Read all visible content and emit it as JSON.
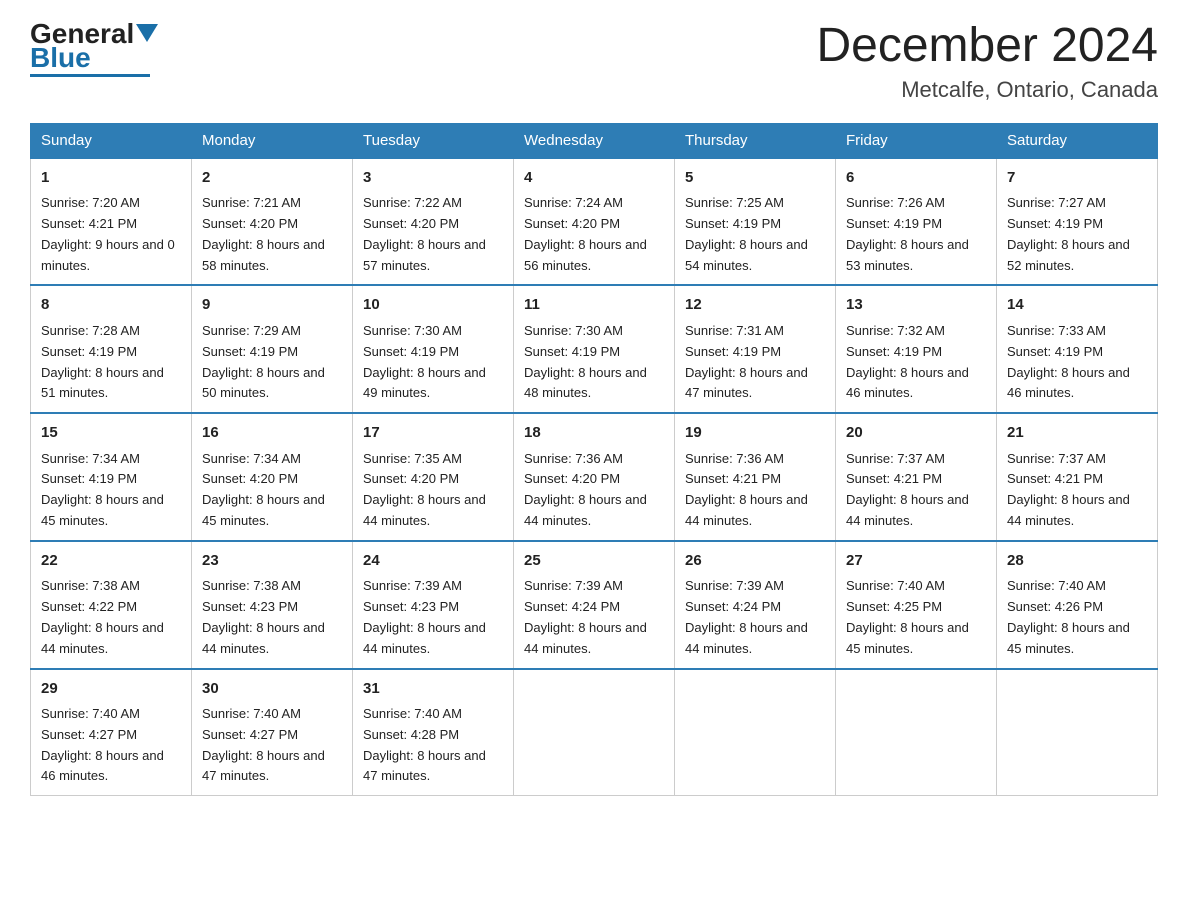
{
  "header": {
    "logo_general": "General",
    "logo_blue": "Blue",
    "month_title": "December 2024",
    "location": "Metcalfe, Ontario, Canada"
  },
  "days_of_week": [
    "Sunday",
    "Monday",
    "Tuesday",
    "Wednesday",
    "Thursday",
    "Friday",
    "Saturday"
  ],
  "weeks": [
    [
      {
        "day": "1",
        "sunrise": "7:20 AM",
        "sunset": "4:21 PM",
        "daylight": "9 hours and 0 minutes."
      },
      {
        "day": "2",
        "sunrise": "7:21 AM",
        "sunset": "4:20 PM",
        "daylight": "8 hours and 58 minutes."
      },
      {
        "day": "3",
        "sunrise": "7:22 AM",
        "sunset": "4:20 PM",
        "daylight": "8 hours and 57 minutes."
      },
      {
        "day": "4",
        "sunrise": "7:24 AM",
        "sunset": "4:20 PM",
        "daylight": "8 hours and 56 minutes."
      },
      {
        "day": "5",
        "sunrise": "7:25 AM",
        "sunset": "4:19 PM",
        "daylight": "8 hours and 54 minutes."
      },
      {
        "day": "6",
        "sunrise": "7:26 AM",
        "sunset": "4:19 PM",
        "daylight": "8 hours and 53 minutes."
      },
      {
        "day": "7",
        "sunrise": "7:27 AM",
        "sunset": "4:19 PM",
        "daylight": "8 hours and 52 minutes."
      }
    ],
    [
      {
        "day": "8",
        "sunrise": "7:28 AM",
        "sunset": "4:19 PM",
        "daylight": "8 hours and 51 minutes."
      },
      {
        "day": "9",
        "sunrise": "7:29 AM",
        "sunset": "4:19 PM",
        "daylight": "8 hours and 50 minutes."
      },
      {
        "day": "10",
        "sunrise": "7:30 AM",
        "sunset": "4:19 PM",
        "daylight": "8 hours and 49 minutes."
      },
      {
        "day": "11",
        "sunrise": "7:30 AM",
        "sunset": "4:19 PM",
        "daylight": "8 hours and 48 minutes."
      },
      {
        "day": "12",
        "sunrise": "7:31 AM",
        "sunset": "4:19 PM",
        "daylight": "8 hours and 47 minutes."
      },
      {
        "day": "13",
        "sunrise": "7:32 AM",
        "sunset": "4:19 PM",
        "daylight": "8 hours and 46 minutes."
      },
      {
        "day": "14",
        "sunrise": "7:33 AM",
        "sunset": "4:19 PM",
        "daylight": "8 hours and 46 minutes."
      }
    ],
    [
      {
        "day": "15",
        "sunrise": "7:34 AM",
        "sunset": "4:19 PM",
        "daylight": "8 hours and 45 minutes."
      },
      {
        "day": "16",
        "sunrise": "7:34 AM",
        "sunset": "4:20 PM",
        "daylight": "8 hours and 45 minutes."
      },
      {
        "day": "17",
        "sunrise": "7:35 AM",
        "sunset": "4:20 PM",
        "daylight": "8 hours and 44 minutes."
      },
      {
        "day": "18",
        "sunrise": "7:36 AM",
        "sunset": "4:20 PM",
        "daylight": "8 hours and 44 minutes."
      },
      {
        "day": "19",
        "sunrise": "7:36 AM",
        "sunset": "4:21 PM",
        "daylight": "8 hours and 44 minutes."
      },
      {
        "day": "20",
        "sunrise": "7:37 AM",
        "sunset": "4:21 PM",
        "daylight": "8 hours and 44 minutes."
      },
      {
        "day": "21",
        "sunrise": "7:37 AM",
        "sunset": "4:21 PM",
        "daylight": "8 hours and 44 minutes."
      }
    ],
    [
      {
        "day": "22",
        "sunrise": "7:38 AM",
        "sunset": "4:22 PM",
        "daylight": "8 hours and 44 minutes."
      },
      {
        "day": "23",
        "sunrise": "7:38 AM",
        "sunset": "4:23 PM",
        "daylight": "8 hours and 44 minutes."
      },
      {
        "day": "24",
        "sunrise": "7:39 AM",
        "sunset": "4:23 PM",
        "daylight": "8 hours and 44 minutes."
      },
      {
        "day": "25",
        "sunrise": "7:39 AM",
        "sunset": "4:24 PM",
        "daylight": "8 hours and 44 minutes."
      },
      {
        "day": "26",
        "sunrise": "7:39 AM",
        "sunset": "4:24 PM",
        "daylight": "8 hours and 44 minutes."
      },
      {
        "day": "27",
        "sunrise": "7:40 AM",
        "sunset": "4:25 PM",
        "daylight": "8 hours and 45 minutes."
      },
      {
        "day": "28",
        "sunrise": "7:40 AM",
        "sunset": "4:26 PM",
        "daylight": "8 hours and 45 minutes."
      }
    ],
    [
      {
        "day": "29",
        "sunrise": "7:40 AM",
        "sunset": "4:27 PM",
        "daylight": "8 hours and 46 minutes."
      },
      {
        "day": "30",
        "sunrise": "7:40 AM",
        "sunset": "4:27 PM",
        "daylight": "8 hours and 47 minutes."
      },
      {
        "day": "31",
        "sunrise": "7:40 AM",
        "sunset": "4:28 PM",
        "daylight": "8 hours and 47 minutes."
      },
      null,
      null,
      null,
      null
    ]
  ]
}
